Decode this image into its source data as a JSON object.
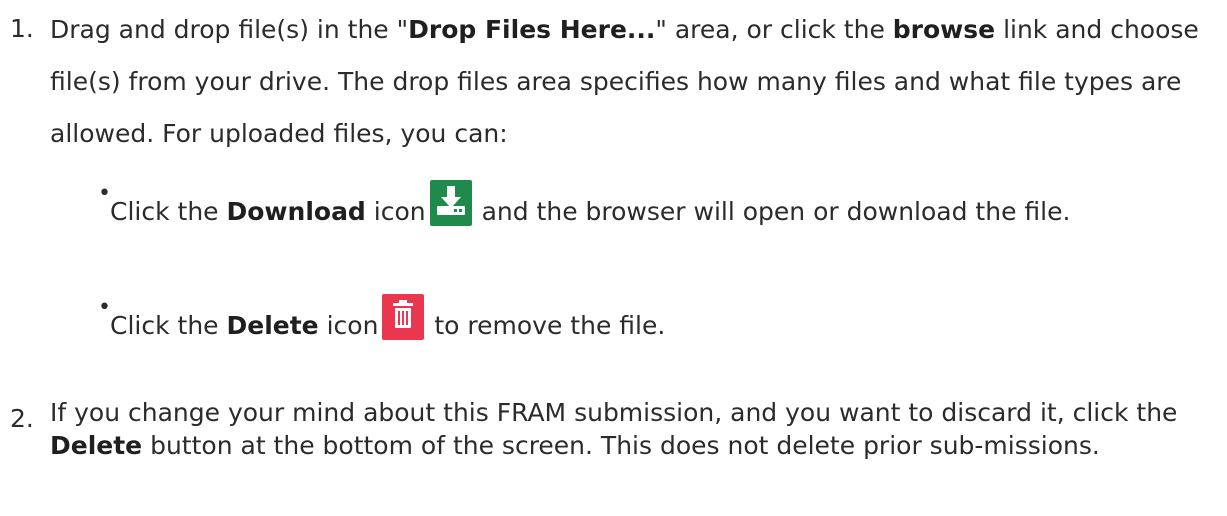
{
  "step1": {
    "number": "1.",
    "intro": "Drag and drop file(s) in the \"",
    "bold_drop": "Drop Files Here...",
    "mid": "\" area, or click the ",
    "bold_browse": "browse",
    "rest": " link and choose file(s) from your drive. The drop files area specifies how many files and what file types are allowed. For uploaded files, you can:",
    "bullets": [
      {
        "prefix": "Click the ",
        "bold": "Download",
        "before_icon": " icon",
        "icon": "download-icon",
        "icon_color": "#1f8a4c",
        "after_icon": " and the browser will open or download the file."
      },
      {
        "prefix": "Click the ",
        "bold": "Delete",
        "before_icon": " icon",
        "icon": "trash-icon",
        "icon_color": "#e8374f",
        "after_icon": " to remove the file."
      }
    ]
  },
  "step2": {
    "number": "2.",
    "intro": "If you change your mind about this FRAM submission, and you want to discard it, click the ",
    "bold": "Delete",
    "rest": " button at the bottom of the screen. This does not delete prior sub-missions."
  }
}
